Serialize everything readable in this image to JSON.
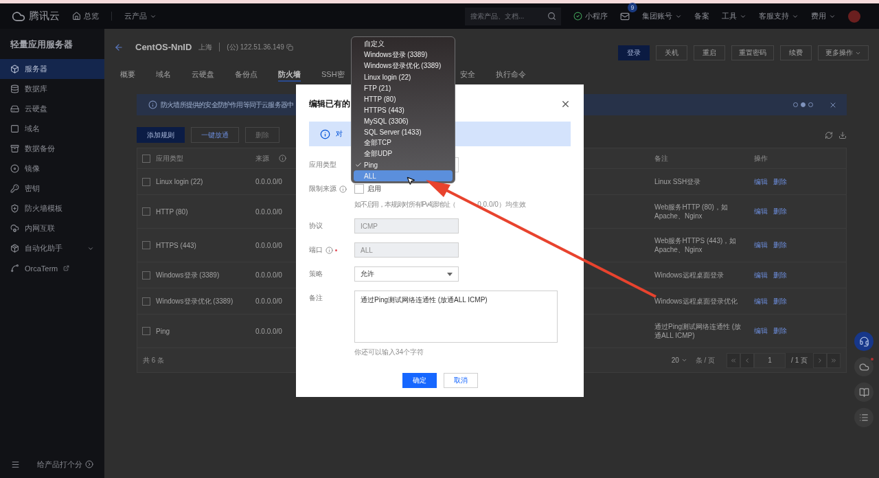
{
  "topbar": {
    "brand": "腾讯云",
    "home": "总览",
    "products": "云产品",
    "search": {
      "placeholder": "搜索产品、文档..."
    },
    "mini_program": "小程序",
    "mail": {
      "badge": "9"
    },
    "nav": [
      {
        "label": "集团账号",
        "dropdown": true
      },
      {
        "label": "备案",
        "dropdown": false
      },
      {
        "label": "工具",
        "dropdown": true
      },
      {
        "label": "客服支持",
        "dropdown": true
      },
      {
        "label": "费用",
        "dropdown": true
      }
    ]
  },
  "sidebar": {
    "title": "轻量应用服务器",
    "items": [
      {
        "label": "服务器",
        "kind": "link",
        "selected": true
      },
      {
        "label": "数据库",
        "kind": "link",
        "selected": false
      },
      {
        "label": "云硬盘",
        "kind": "link",
        "selected": false
      },
      {
        "label": "域名",
        "kind": "link",
        "selected": false
      },
      {
        "label": "数据备份",
        "kind": "link",
        "selected": false
      },
      {
        "label": "镜像",
        "kind": "link",
        "selected": false
      },
      {
        "label": "密钥",
        "kind": "link",
        "selected": false
      },
      {
        "label": "防火墙模板",
        "kind": "link",
        "selected": false
      },
      {
        "label": "内网互联",
        "kind": "link",
        "selected": false
      },
      {
        "label": "自动化助手",
        "kind": "group",
        "selected": false
      },
      {
        "label": "OrcaTerm",
        "kind": "external",
        "selected": false
      }
    ],
    "footer": "给产品打个分"
  },
  "server": {
    "name": "CentOS-NnID",
    "region": "上海",
    "ip": "(公) 122.51.36.149"
  },
  "actions": [
    {
      "label": "登录",
      "kind": "primary"
    },
    {
      "label": "关机",
      "kind": "default"
    },
    {
      "label": "重启",
      "kind": "default"
    },
    {
      "label": "重置密码",
      "kind": "default"
    },
    {
      "label": "续费",
      "kind": "default"
    },
    {
      "label": "更多操作",
      "kind": "dropdown"
    }
  ],
  "tabs": [
    {
      "label": "概要",
      "selected": false
    },
    {
      "label": "域名",
      "selected": false
    },
    {
      "label": "云硬盘",
      "selected": false
    },
    {
      "label": "备份点",
      "selected": false
    },
    {
      "label": "防火墙",
      "selected": true
    },
    {
      "label": "SSH密",
      "selected": false
    },
    {
      "label": "安全",
      "selected": false
    },
    {
      "label": "执行命令",
      "selected": false
    }
  ],
  "notice": {
    "text": "防火墙所提供的安全防护作用等同于云服务器中",
    "dots": [
      {
        "selected": false
      },
      {
        "selected": true
      },
      {
        "selected": false
      }
    ]
  },
  "toolbar": [
    {
      "label": "添加规则",
      "kind": "primary",
      "disabled": false
    },
    {
      "label": "一键放通",
      "kind": "default",
      "disabled": false
    },
    {
      "label": "删除",
      "kind": "default",
      "disabled": true
    }
  ],
  "table": {
    "all_checked": false,
    "columns": [
      {
        "label": "应用类型",
        "info": false
      },
      {
        "label": "来源",
        "info": true
      },
      {
        "label": "备注",
        "info": false
      },
      {
        "label": "操作",
        "info": false
      }
    ],
    "rows": [
      {
        "checked": false,
        "type": "Linux login (22)",
        "source": "0.0.0.0/0",
        "remark": "Linux SSH登录",
        "actions": [
          "编辑",
          "删除"
        ]
      },
      {
        "checked": false,
        "type": "HTTP (80)",
        "source": "0.0.0.0/0",
        "remark": "Web服务HTTP (80)，如Apache、Nginx",
        "actions": [
          "编辑",
          "删除"
        ]
      },
      {
        "checked": false,
        "type": "HTTPS (443)",
        "source": "0.0.0.0/0",
        "remark": "Web服务HTTPS (443)，如Apache、Nginx",
        "actions": [
          "编辑",
          "删除"
        ]
      },
      {
        "checked": false,
        "type": "Windows登录 (3389)",
        "source": "0.0.0.0/0",
        "remark": "Windows远程桌面登录",
        "actions": [
          "编辑",
          "删除"
        ]
      },
      {
        "checked": false,
        "type": "Windows登录优化 (3389)",
        "source": "0.0.0.0/0",
        "remark": "Windows远程桌面登录优化",
        "actions": [
          "编辑",
          "删除"
        ]
      },
      {
        "checked": false,
        "type": "Ping",
        "source": "0.0.0.0/0",
        "remark": "通过Ping测试网络连通性 (放通ALL ICMP)",
        "actions": [
          "编辑",
          "删除"
        ]
      }
    ],
    "total": "共 6 条",
    "page_size": "20",
    "page_size_unit": "条 / 页",
    "page": "1",
    "pages": "/ 1 页"
  },
  "dialog": {
    "title": "编辑已有的",
    "notice": "对",
    "fields": [
      {
        "label": "应用类型",
        "kind": "select",
        "info": false,
        "required": false
      },
      {
        "label": "限制来源",
        "kind": "checkbox",
        "info": true,
        "required": false,
        "option": "启用",
        "checked": false,
        "hint": "如不启用，本规则对所有IPv4源地址（",
        "hint_tail": "0.0.0/0）均生效"
      },
      {
        "label": "协议",
        "kind": "input",
        "info": false,
        "required": false,
        "value": "ICMP",
        "disabled": true
      },
      {
        "label": "端口",
        "kind": "input",
        "info": true,
        "required": true,
        "value": "ALL",
        "disabled": true
      },
      {
        "label": "策略",
        "kind": "select",
        "info": false,
        "required": false,
        "value": "允许"
      },
      {
        "label": "备注",
        "kind": "textarea",
        "info": false,
        "required": false,
        "value": "通过Ping测试网络连通性 (放通ALL ICMP)",
        "hint": "你还可以输入34个字符"
      }
    ],
    "buttons": [
      {
        "label": "确定",
        "kind": "primary"
      },
      {
        "label": "取消",
        "kind": "default"
      }
    ]
  },
  "menu": {
    "items": [
      {
        "label": "自定义",
        "selected": false,
        "hovered": false
      },
      {
        "label": "Windows登录 (3389)",
        "selected": false,
        "hovered": false
      },
      {
        "label": "Windows登录优化 (3389)",
        "selected": false,
        "hovered": false
      },
      {
        "label": "Linux login (22)",
        "selected": false,
        "hovered": false
      },
      {
        "label": "FTP (21)",
        "selected": false,
        "hovered": false
      },
      {
        "label": "HTTP (80)",
        "selected": false,
        "hovered": false
      },
      {
        "label": "HTTPS (443)",
        "selected": false,
        "hovered": false
      },
      {
        "label": "MySQL (3306)",
        "selected": false,
        "hovered": false
      },
      {
        "label": "SQL Server (1433)",
        "selected": false,
        "hovered": false
      },
      {
        "label": "全部TCP",
        "selected": false,
        "hovered": false
      },
      {
        "label": "全部UDP",
        "selected": false,
        "hovered": false
      },
      {
        "label": "Ping",
        "selected": true,
        "hovered": false
      },
      {
        "label": "ALL",
        "selected": false,
        "hovered": true
      }
    ]
  }
}
